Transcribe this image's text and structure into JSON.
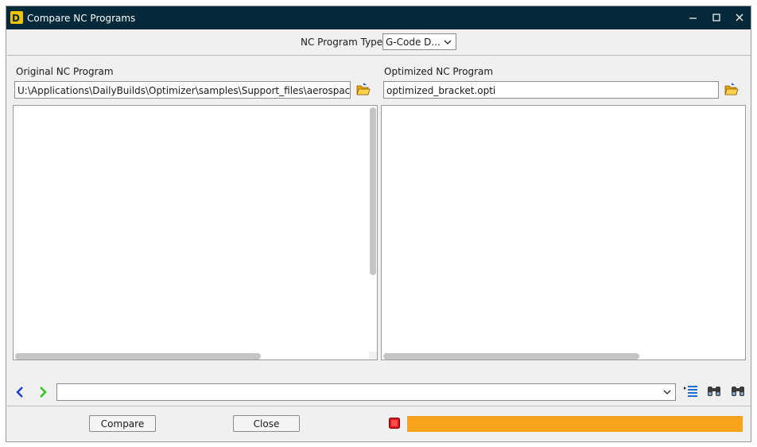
{
  "window": {
    "title": "Compare NC Programs"
  },
  "nc_type": {
    "label": "NC Program Type",
    "selected": "G-Code D..."
  },
  "original": {
    "label": "Original NC Program",
    "path": "U:\\Applications\\DailyBuilds\\Optimizer\\samples\\Support_files\\aerospace_bracket.nc"
  },
  "optimized": {
    "label": "Optimized NC Program",
    "path": "optimized_bracket.opti"
  },
  "search": {
    "value": ""
  },
  "buttons": {
    "compare": "Compare",
    "close": "Close"
  },
  "progress": {
    "fraction": 1.0
  },
  "colors": {
    "titlebar": "#04293a",
    "progress": "#f9a21b",
    "stop": "#e0121b",
    "back_arrow": "#1a3fd6",
    "forward_arrow": "#27c321"
  },
  "icons": [
    "app-logo-icon",
    "minimize-icon",
    "maximize-icon",
    "close-icon",
    "open-folder-icon",
    "back-arrow-icon",
    "forward-arrow-icon",
    "list-icon",
    "binoculars-icon",
    "binoculars-alt-icon",
    "stop-icon",
    "chevron-down-icon"
  ]
}
